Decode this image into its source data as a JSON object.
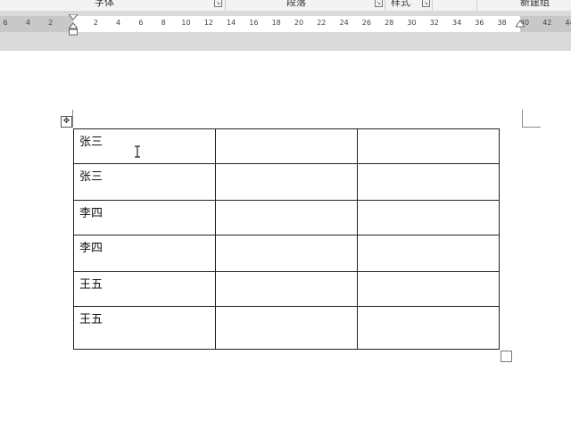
{
  "ribbon": {
    "groups": [
      {
        "label": "字体",
        "has_launcher": true
      },
      {
        "label": "段落",
        "has_launcher": true
      },
      {
        "label": "样式",
        "has_launcher": true
      },
      {
        "label": "新建组",
        "has_launcher": false
      }
    ],
    "launcher_icon": "dialog-launcher-icon"
  },
  "ruler": {
    "ticks": [
      "6",
      "4",
      "2",
      "2",
      "4",
      "6",
      "8",
      "10",
      "12",
      "14",
      "16",
      "18",
      "20",
      "22",
      "24",
      "26",
      "28",
      "30",
      "32",
      "34",
      "36",
      "38",
      "40",
      "42",
      "44"
    ]
  },
  "table": {
    "rows": [
      [
        "张三",
        "",
        ""
      ],
      [
        "张三",
        "",
        ""
      ],
      [
        "李四",
        "",
        ""
      ],
      [
        "李四",
        "",
        ""
      ],
      [
        "王五",
        "",
        ""
      ],
      [
        "王五",
        "",
        ""
      ]
    ]
  },
  "icons": {
    "move": "table-move-handle-icon",
    "resize": "table-resize-handle-icon",
    "cursor": "ibeam-cursor-icon"
  },
  "colors": {
    "ruler_margin": "#c8c8c8",
    "workspace": "#dadada",
    "table_border": "#222222"
  }
}
